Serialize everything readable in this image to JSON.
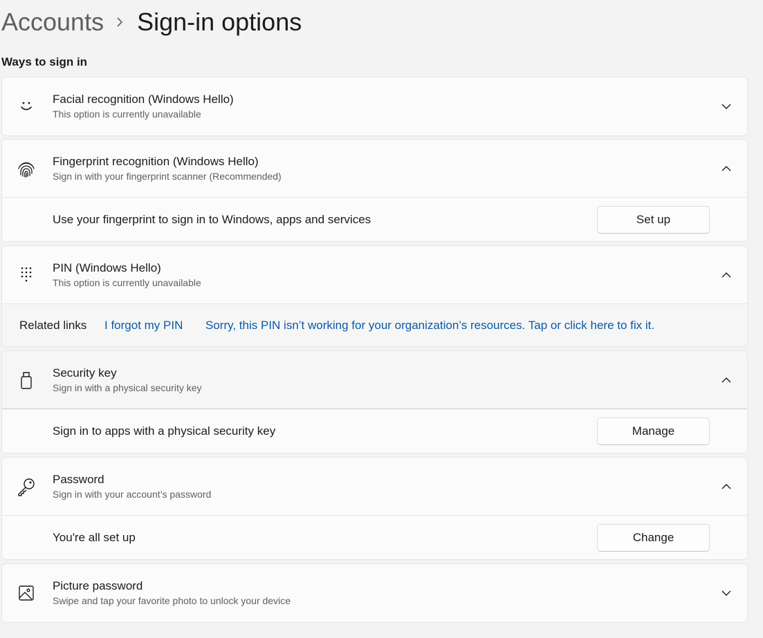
{
  "breadcrumb": {
    "parent": "Accounts",
    "separator_icon": "chevron-right-icon",
    "current": "Sign-in options"
  },
  "section_label": "Ways to sign in",
  "options": {
    "facial": {
      "icon": "smiley-face-icon",
      "title": "Facial recognition (Windows Hello)",
      "subtitle": "This option is currently unavailable",
      "expanded": false
    },
    "fingerprint": {
      "icon": "fingerprint-icon",
      "title": "Fingerprint recognition (Windows Hello)",
      "subtitle": "Sign in with your fingerprint scanner (Recommended)",
      "expanded": true,
      "body_text": "Use your fingerprint to sign in to Windows, apps and services",
      "button_label": "Set up"
    },
    "pin": {
      "icon": "keypad-icon",
      "title": "PIN (Windows Hello)",
      "subtitle": "This option is currently unavailable",
      "expanded": true,
      "related_links_label": "Related links",
      "link_forgot": "I forgot my PIN",
      "link_fix": "Sorry, this PIN isn’t working for your organization’s resources. Tap or click here to fix it."
    },
    "security_key": {
      "icon": "usb-key-icon",
      "title": "Security key",
      "subtitle": "Sign in with a physical security key",
      "expanded": true,
      "body_text": "Sign in to apps with a physical security key",
      "button_label": "Manage"
    },
    "password": {
      "icon": "key-icon",
      "title": "Password",
      "subtitle": "Sign in with your account’s password",
      "expanded": true,
      "body_text": "You're all set up",
      "button_label": "Change"
    },
    "picture_password": {
      "icon": "picture-icon",
      "title": "Picture password",
      "subtitle": "Swipe and tap your favorite photo to unlock your device",
      "expanded": false
    }
  },
  "colors": {
    "background": "#f3f3f3",
    "card": "#fbfbfb",
    "link": "#0a59a6",
    "secondary_text": "#5f5f5f"
  }
}
